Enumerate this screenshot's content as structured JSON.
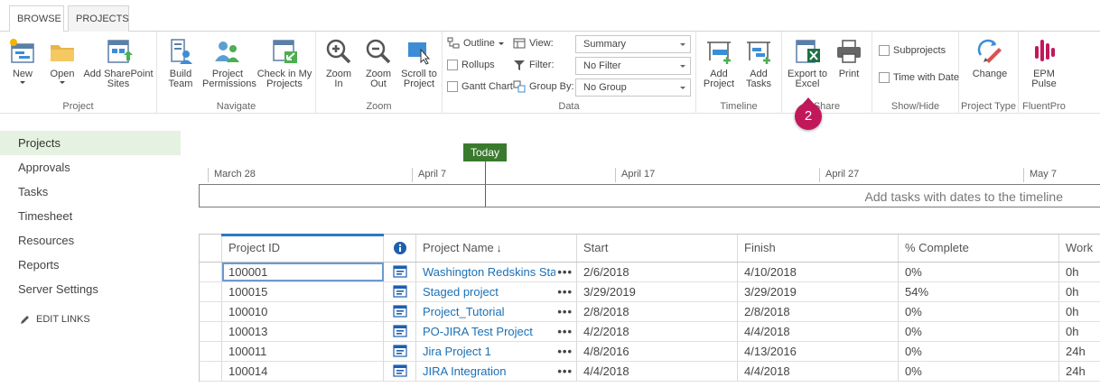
{
  "tabs": {
    "browse": "BROWSE",
    "projects": "PROJECTS"
  },
  "ribbon": {
    "project": {
      "label": "Project",
      "new": "New",
      "open": "Open",
      "add_sharepoint_1": "Add SharePoint",
      "add_sharepoint_2": "Sites"
    },
    "navigate": {
      "label": "Navigate",
      "build_1": "Build",
      "build_2": "Team",
      "perm_1": "Project",
      "perm_2": "Permissions",
      "check_1": "Check in My",
      "check_2": "Projects"
    },
    "zoom": {
      "label": "Zoom",
      "in_1": "Zoom",
      "in_2": "In",
      "out_1": "Zoom",
      "out_2": "Out",
      "scroll_1": "Scroll to",
      "scroll_2": "Project"
    },
    "data": {
      "label": "Data",
      "outline": "Outline",
      "rollups": "Rollups",
      "gantt": "Gantt Chart",
      "view": "View:",
      "filter": "Filter:",
      "group_by": "Group By:",
      "view_value": "Summary",
      "filter_value": "No Filter",
      "group_value": "No Group"
    },
    "timeline": {
      "label": "Timeline",
      "add_project_1": "Add",
      "add_project_2": "Project",
      "add_tasks_1": "Add",
      "add_tasks_2": "Tasks"
    },
    "share": {
      "label": "Share",
      "export_1": "Export to",
      "export_2": "Excel",
      "print": "Print"
    },
    "showhide": {
      "label": "Show/Hide",
      "subprojects": "Subprojects",
      "time_with_date": "Time with Date"
    },
    "project_type": {
      "label": "Project Type",
      "change": "Change"
    },
    "fluentpro": {
      "label": "FluentPro",
      "epm_1": "EPM",
      "epm_2": "Pulse"
    }
  },
  "callout": {
    "number": "2"
  },
  "nav": {
    "items": [
      "Projects",
      "Approvals",
      "Tasks",
      "Timesheet",
      "Resources",
      "Reports",
      "Server Settings"
    ],
    "edit_links": "EDIT LINKS"
  },
  "timeline": {
    "today": "Today",
    "ticks": [
      "March 28",
      "April 7",
      "April 17",
      "April 27",
      "May 7"
    ],
    "hint": "Add tasks with dates to the timeline"
  },
  "grid": {
    "headers": {
      "project_id": "Project ID",
      "project_name": "Project Name",
      "sort_arrow": "↓",
      "start": "Start",
      "finish": "Finish",
      "complete": "% Complete",
      "work": "Work"
    },
    "rows": [
      {
        "id": "100001",
        "name": "Washington Redskins Start",
        "start": "2/6/2018",
        "finish": "4/10/2018",
        "complete": "0%",
        "work": "0h"
      },
      {
        "id": "100015",
        "name": "Staged project",
        "start": "3/29/2019",
        "finish": "3/29/2019",
        "complete": "54%",
        "work": "0h"
      },
      {
        "id": "100010",
        "name": "Project_Tutorial",
        "start": "2/8/2018",
        "finish": "2/8/2018",
        "complete": "0%",
        "work": "0h"
      },
      {
        "id": "100013",
        "name": "PO-JIRA Test Project",
        "start": "4/2/2018",
        "finish": "4/4/2018",
        "complete": "0%",
        "work": "0h"
      },
      {
        "id": "100011",
        "name": "Jira Project 1",
        "start": "4/8/2016",
        "finish": "4/13/2016",
        "complete": "0%",
        "work": "24h"
      },
      {
        "id": "100014",
        "name": "JIRA Integration",
        "start": "4/4/2018",
        "finish": "4/4/2018",
        "complete": "0%",
        "work": "24h"
      }
    ],
    "more": "•••"
  },
  "colors": {
    "accent_blue": "#1a6fb5",
    "today_green": "#3a7a2e",
    "callout_pink": "#c2185b",
    "nav_active": "#e6f2e1"
  }
}
